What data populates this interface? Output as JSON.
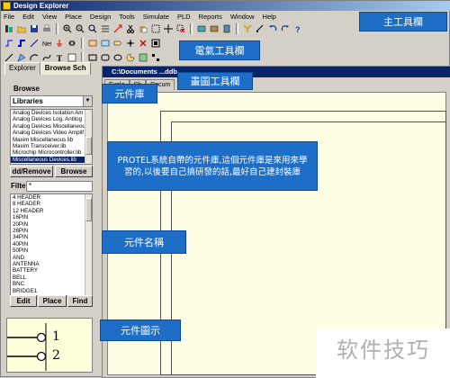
{
  "window": {
    "title": "Design Explorer"
  },
  "menu": [
    "File",
    "Edit",
    "View",
    "Place",
    "Design",
    "Tools",
    "Simulate",
    "PLD",
    "Reports",
    "Window",
    "Help"
  ],
  "annotations": {
    "main_toolbar": "主工具欄",
    "electrical_toolbar": "電氣工具欄",
    "drawing_toolbar": "畫圖工具欄",
    "library": "元件庫",
    "library_note": "PROTEL系統自帶的元件庫,這個元件庫是來用來學習的,以後要自己搞研發的話,最好自己建封裝庫",
    "component_name": "元件名稱",
    "component_preview": "元件圖示"
  },
  "explorer": {
    "tabs": [
      "Explorer",
      "Browse Sch"
    ],
    "browse_label": "Browse",
    "browse_value": "Libraries",
    "libraries": [
      "Analog Devices Isolation Am",
      "Analog Devices Log. Antilog",
      "Analog Devices Miscellaneou",
      "Analog Devices Video Amplif",
      "Maxim Miscellaneous lib",
      "Maxim Transceiver.lib",
      "Microchip Microcontroller.lib",
      "Miscellaneous Devices.lib"
    ],
    "add_remove_label": "dd/Remove",
    "browse_button": "Browse",
    "filter_label": "Filte",
    "filter_value": "*",
    "components": [
      "4 HEADER",
      "8 HEADER",
      "12 HEADER",
      "16PIN",
      "20PIN",
      "26PIN",
      "34PIN",
      "40PIN",
      "50PIN",
      "AND",
      "ANTENNA",
      "BATTERY",
      "BELL",
      "BNC",
      "BRIDGE1"
    ],
    "edit_button": "Edit",
    "place_button": "Place",
    "find_button": "Find",
    "preview_pins": [
      "1",
      "2"
    ]
  },
  "document": {
    "title": "C:\\Documents ...ddb",
    "tabs": [
      "Explo",
      "Sh",
      "Docum"
    ]
  },
  "watermark": "软件技巧",
  "colors": {
    "callout": "#1e6ec8",
    "titlebar": "#0a246a",
    "canvas": "#ffffe6"
  }
}
